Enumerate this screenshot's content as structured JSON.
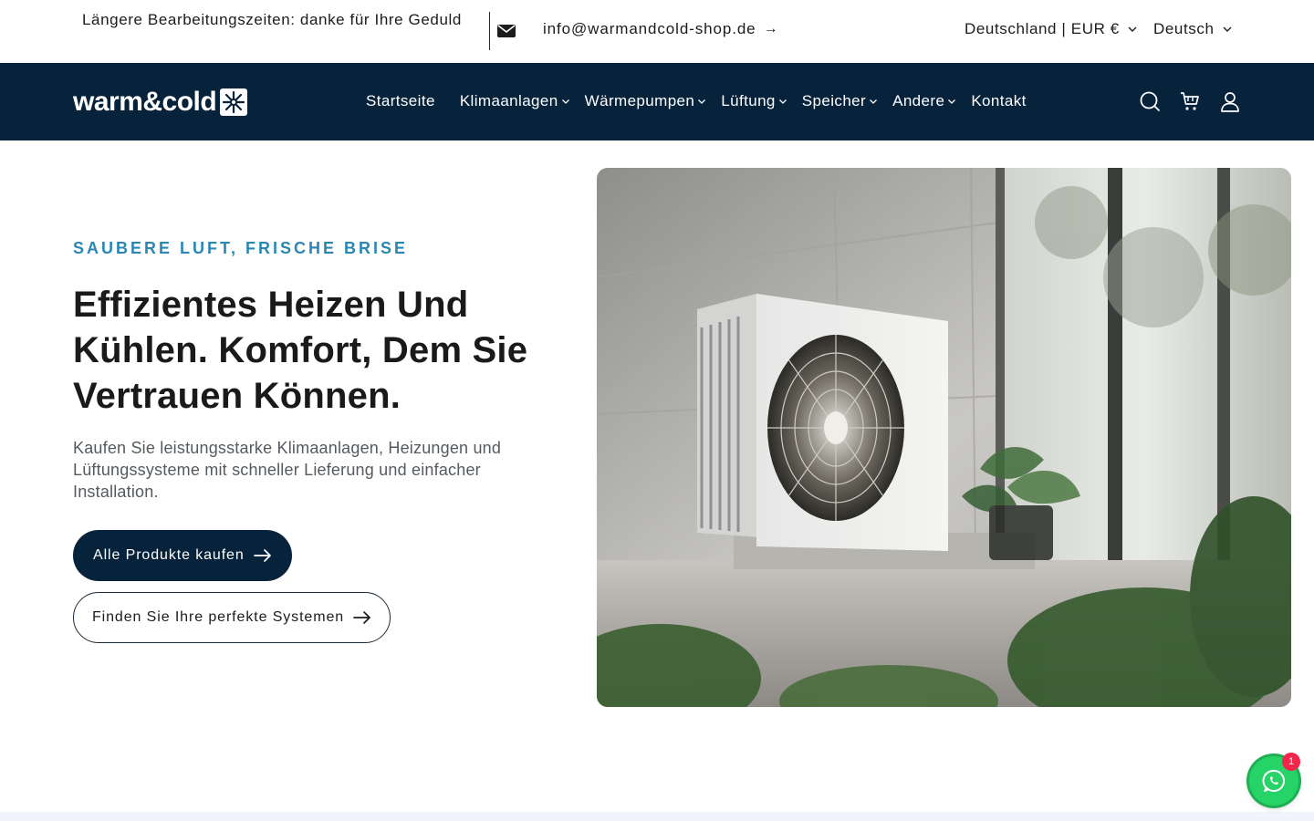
{
  "topbar": {
    "notice": "Längere Bearbeitungszeiten: danke für Ihre Geduld",
    "email": "info@warmandcold-shop.de",
    "email_arrow": "→",
    "country": "Deutschland | EUR €",
    "language": "Deutsch"
  },
  "header": {
    "logo_text": "warm&cold",
    "nav": [
      {
        "label": "Startseite",
        "has_dropdown": false
      },
      {
        "label": "Klimaanlagen",
        "has_dropdown": true
      },
      {
        "label": "Wärmepumpen",
        "has_dropdown": true
      },
      {
        "label": "Lüftung",
        "has_dropdown": true
      },
      {
        "label": "Speicher",
        "has_dropdown": true
      },
      {
        "label": "Andere",
        "has_dropdown": true
      },
      {
        "label": "Kontakt",
        "has_dropdown": false
      }
    ],
    "icons": [
      "search-icon",
      "cart-icon",
      "account-icon"
    ]
  },
  "hero": {
    "eyebrow": "SAUBERE LUFT, FRISCHE BRISE",
    "title": "Effizientes Heizen Und Kühlen. Komfort, Dem Sie Vertrauen Können.",
    "subtitle": "Kaufen Sie leistungsstarke Klimaanlagen, Heizungen und Lüftungssysteme mit schneller Lieferung und einfacher Installation.",
    "primary_button": "Alle Produkte kaufen",
    "secondary_button": "Finden Sie Ihre perfekte Systemen"
  },
  "chat": {
    "badge_count": "1",
    "icon": "whatsapp-icon",
    "color": "#25d366"
  },
  "colors": {
    "header_bg": "#07223b",
    "accent": "#2b86b4",
    "badge": "#f2264a"
  }
}
